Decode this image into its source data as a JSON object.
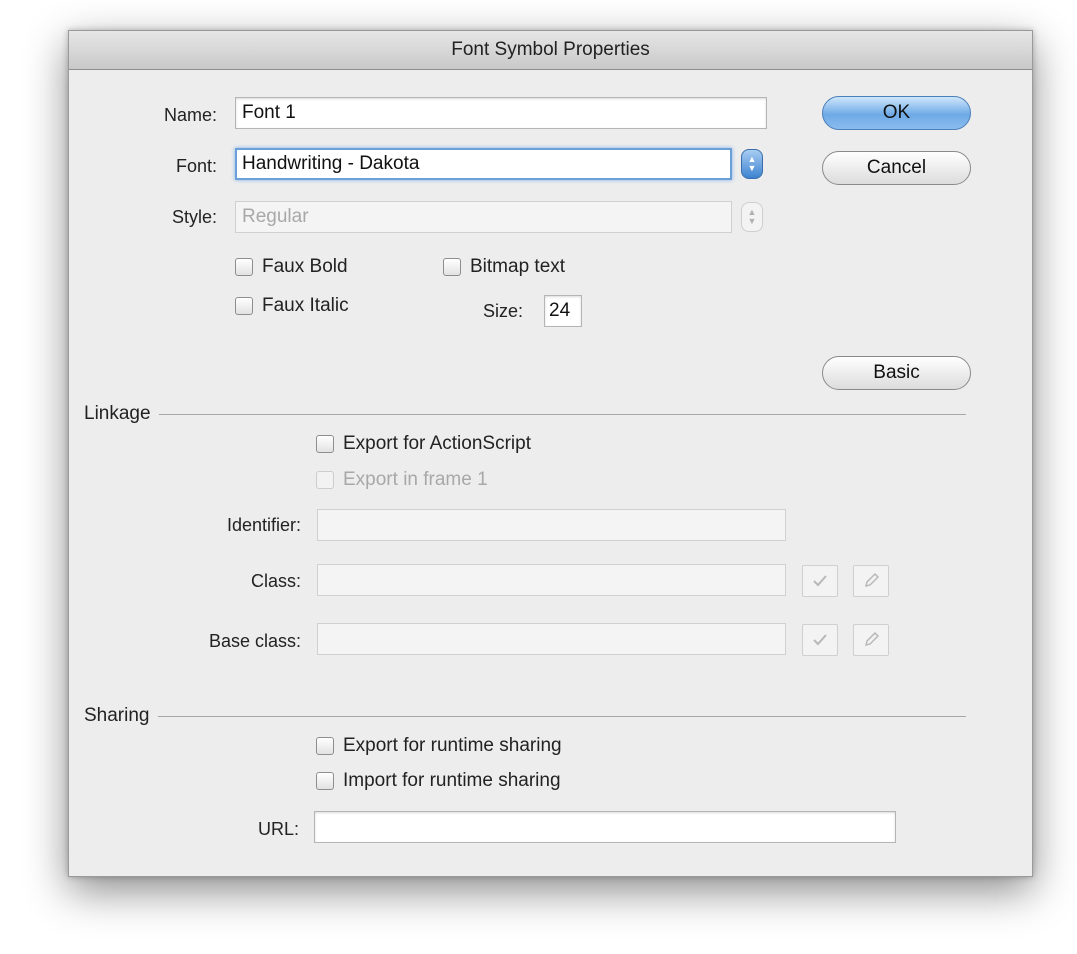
{
  "dialog": {
    "title": "Font Symbol Properties"
  },
  "fields": {
    "name": {
      "label": "Name:",
      "value": "Font 1"
    },
    "font": {
      "label": "Font:",
      "value": "Handwriting - Dakota"
    },
    "style": {
      "label": "Style:",
      "value": "Regular"
    },
    "size": {
      "label": "Size:",
      "value": "24"
    }
  },
  "options": {
    "faux_bold": {
      "label": "Faux Bold",
      "checked": false
    },
    "faux_italic": {
      "label": "Faux Italic",
      "checked": false
    },
    "bitmap_text": {
      "label": "Bitmap text",
      "checked": false
    }
  },
  "buttons": {
    "ok": "OK",
    "cancel": "Cancel",
    "basic": "Basic"
  },
  "linkage": {
    "title": "Linkage",
    "export_actionscript": "Export for ActionScript",
    "export_frame1": "Export in frame 1",
    "identifier_label": "Identifier:",
    "class_label": "Class:",
    "base_class_label": "Base class:",
    "identifier_value": "",
    "class_value": "",
    "base_class_value": ""
  },
  "sharing": {
    "title": "Sharing",
    "export_runtime": "Export for runtime sharing",
    "import_runtime": "Import for runtime sharing",
    "url_label": "URL:",
    "url_value": ""
  },
  "icons": {
    "validate": "checkmark-icon",
    "edit": "pencil-icon"
  },
  "colors": {
    "default_button": "#6eaae6",
    "focus_ring": "#6a9fd8"
  }
}
